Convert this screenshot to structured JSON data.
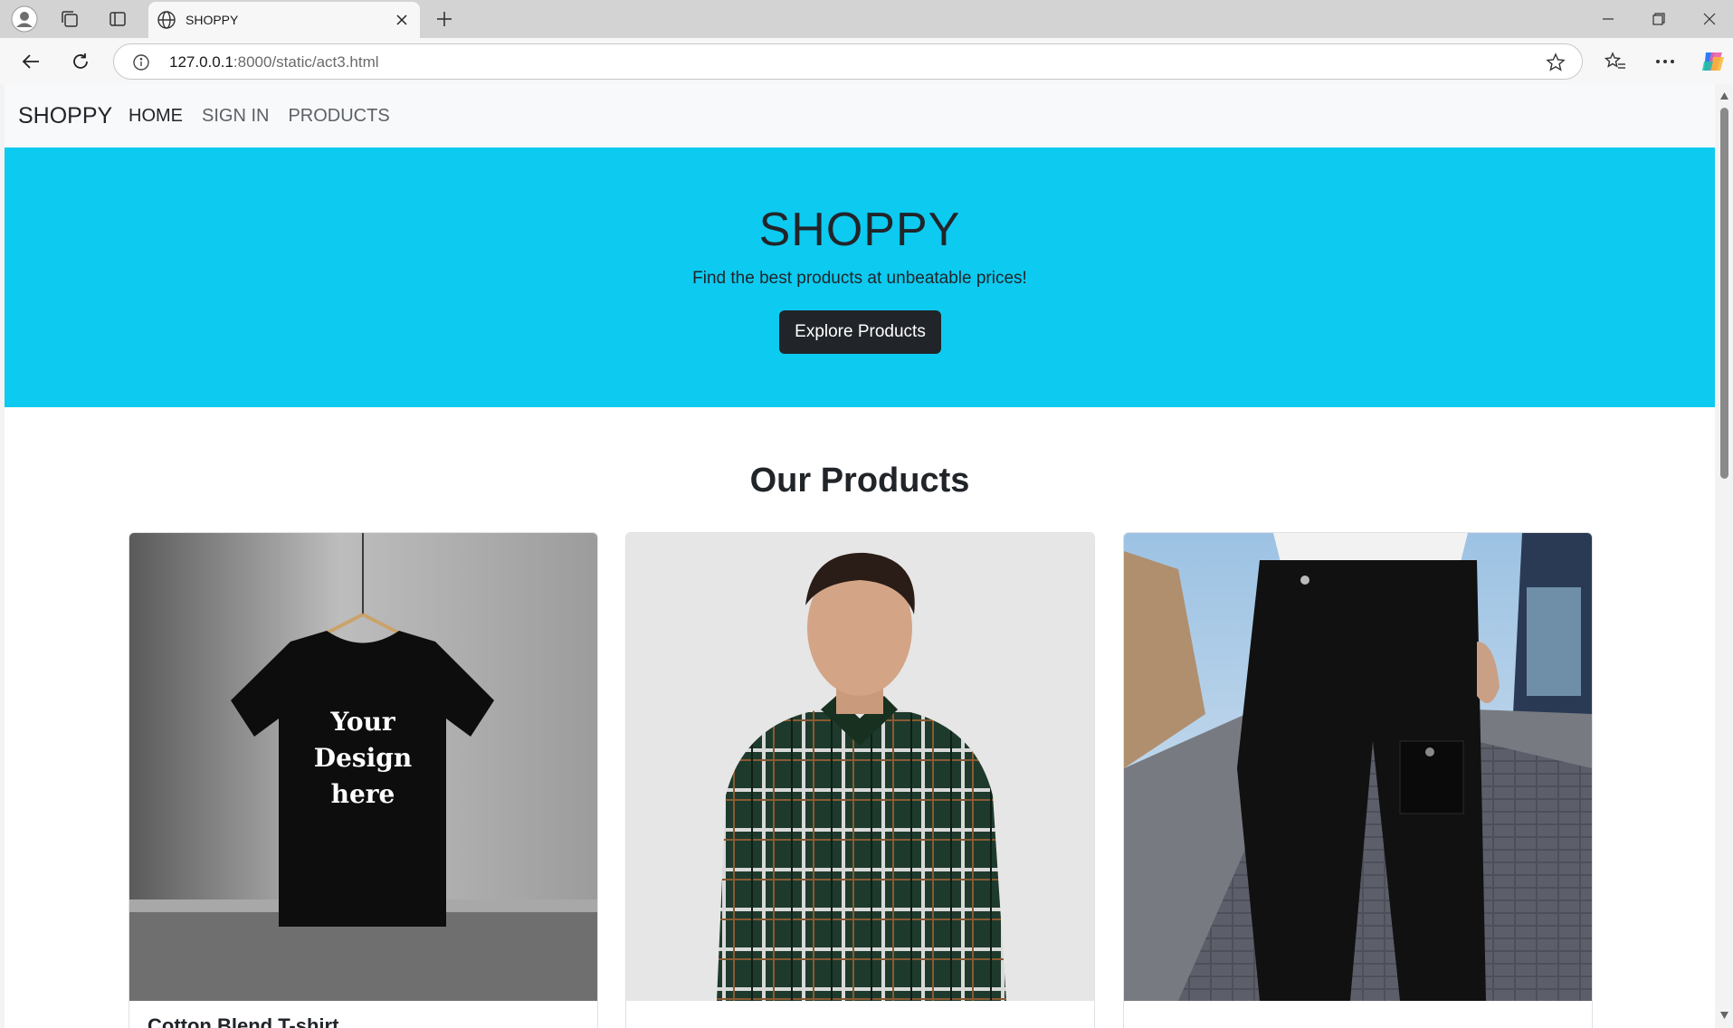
{
  "browser": {
    "tab_title": "SHOPPY",
    "url_host": "127.0.0.1",
    "url_path": ":8000/static/act3.html"
  },
  "site": {
    "brand": "SHOPPY",
    "nav": [
      {
        "label": "HOME",
        "active": true
      },
      {
        "label": "SIGN IN",
        "active": false
      },
      {
        "label": "PRODUCTS",
        "active": false
      }
    ]
  },
  "hero": {
    "title": "SHOPPY",
    "subtitle": "Find the best products at unbeatable prices!",
    "button": "Explore Products",
    "background": "#0dcaf0"
  },
  "products": {
    "heading": "Our Products",
    "items": [
      {
        "title": "Cotton Blend T-shirt",
        "image_text": [
          "Your",
          "Design",
          "here"
        ]
      },
      {
        "title": "",
        "image": "plaid-shirt-model"
      },
      {
        "title": "",
        "image": "black-cargo-pants"
      }
    ]
  },
  "icons": {
    "profile": "profile-icon",
    "collections": "collections-icon",
    "tab_actions": "tab-actions-icon",
    "globe": "globe-icon",
    "favorites": "favorites-icon",
    "more": "more-icon",
    "copilot": "copilot-icon"
  }
}
